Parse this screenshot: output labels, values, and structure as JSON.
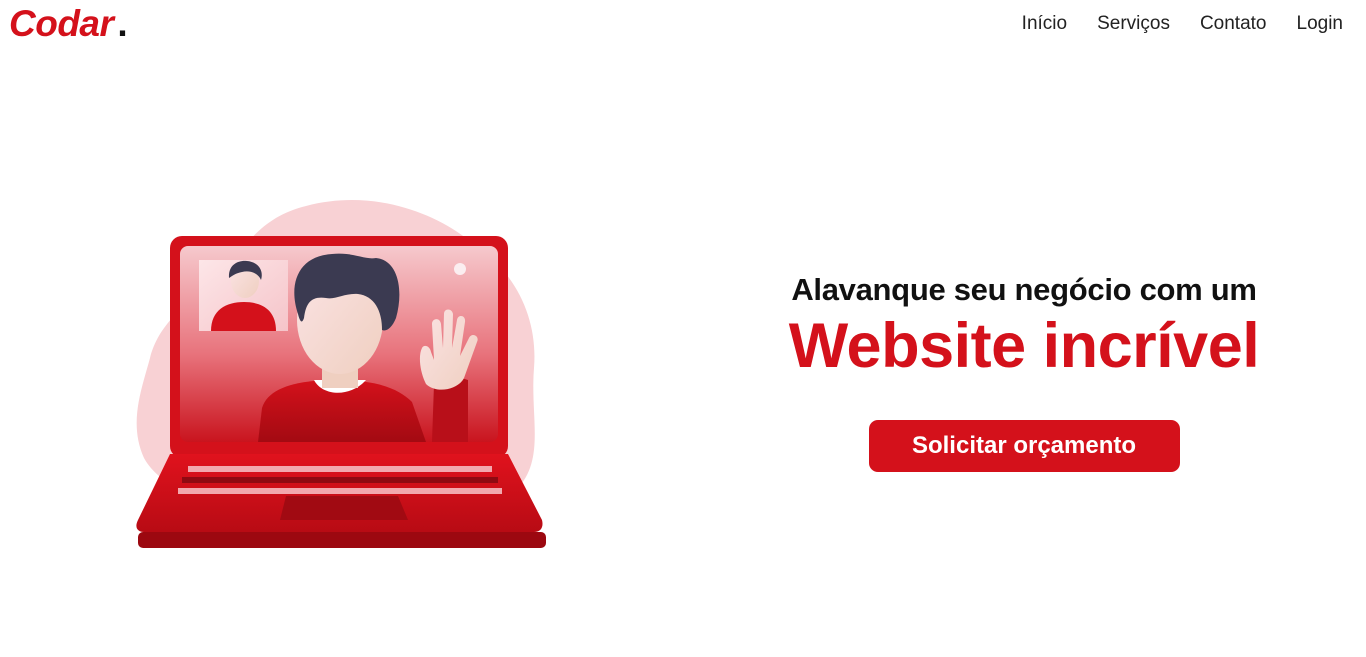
{
  "header": {
    "logo_text": "Codar",
    "logo_dot": ".",
    "nav": [
      {
        "label": "Início"
      },
      {
        "label": "Serviços"
      },
      {
        "label": "Contato"
      },
      {
        "label": "Login"
      }
    ]
  },
  "hero": {
    "subtitle": "Alavanque seu negócio com um",
    "title": "Website incrível",
    "cta_label": "Solicitar orçamento"
  },
  "colors": {
    "brand": "#d4111b",
    "text_dark": "#111111",
    "background": "#ffffff"
  }
}
